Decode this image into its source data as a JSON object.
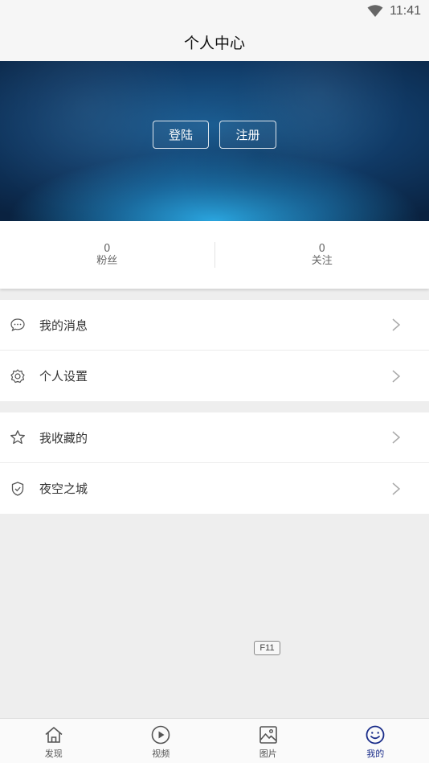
{
  "status_bar": {
    "time": "11:41"
  },
  "header": {
    "title": "个人中心"
  },
  "banner": {
    "login_label": "登陆",
    "register_label": "注册"
  },
  "stats": [
    {
      "value": "0",
      "label": "粉丝"
    },
    {
      "value": "0",
      "label": "关注"
    }
  ],
  "menu": {
    "group1": [
      {
        "icon": "message-icon",
        "label": "我的消息"
      },
      {
        "icon": "gear-icon",
        "label": "个人设置"
      }
    ],
    "group2": [
      {
        "icon": "star-icon",
        "label": "我收藏的"
      },
      {
        "icon": "shield-icon",
        "label": "夜空之城"
      }
    ]
  },
  "key_hint": "F11",
  "tabs": [
    {
      "icon": "home-icon",
      "label": "发现",
      "active": false
    },
    {
      "icon": "play-icon",
      "label": "视频",
      "active": false
    },
    {
      "icon": "image-icon",
      "label": "图片",
      "active": false
    },
    {
      "icon": "smile-icon",
      "label": "我的",
      "active": true
    }
  ],
  "colors": {
    "active_tab": "#1a2d8a",
    "banner_blue": "#1c5f95"
  }
}
